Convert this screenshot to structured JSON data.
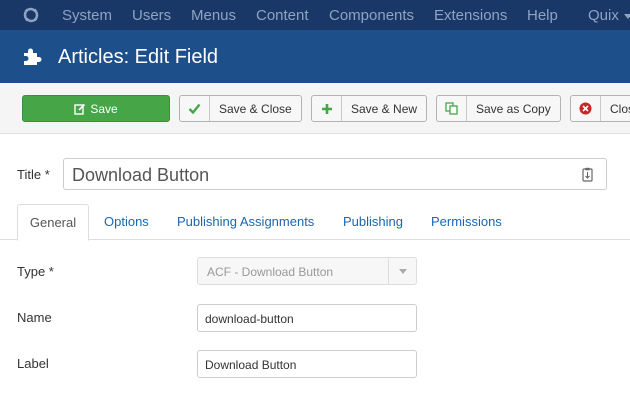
{
  "menubar": {
    "items": [
      "System",
      "Users",
      "Menus",
      "Content",
      "Components",
      "Extensions",
      "Help",
      "Quix"
    ]
  },
  "header": {
    "title": "Articles: Edit Field"
  },
  "toolbar": {
    "save": "Save",
    "save_close": "Save & Close",
    "save_new": "Save & New",
    "save_copy": "Save as Copy",
    "close": "Close"
  },
  "title_field": {
    "label": "Title *",
    "value": "Download Button"
  },
  "tabs": [
    "General",
    "Options",
    "Publishing Assignments",
    "Publishing",
    "Permissions"
  ],
  "form": {
    "type_label": "Type *",
    "type_value": "ACF - Download Button",
    "name_label": "Name",
    "name_value": "download-button",
    "label_label": "Label",
    "label_value": "Download Button"
  },
  "colors": {
    "menubar": "#1a3867",
    "header": "#1d4f8a",
    "save_button": "#46a546",
    "link": "#1a66b3"
  }
}
